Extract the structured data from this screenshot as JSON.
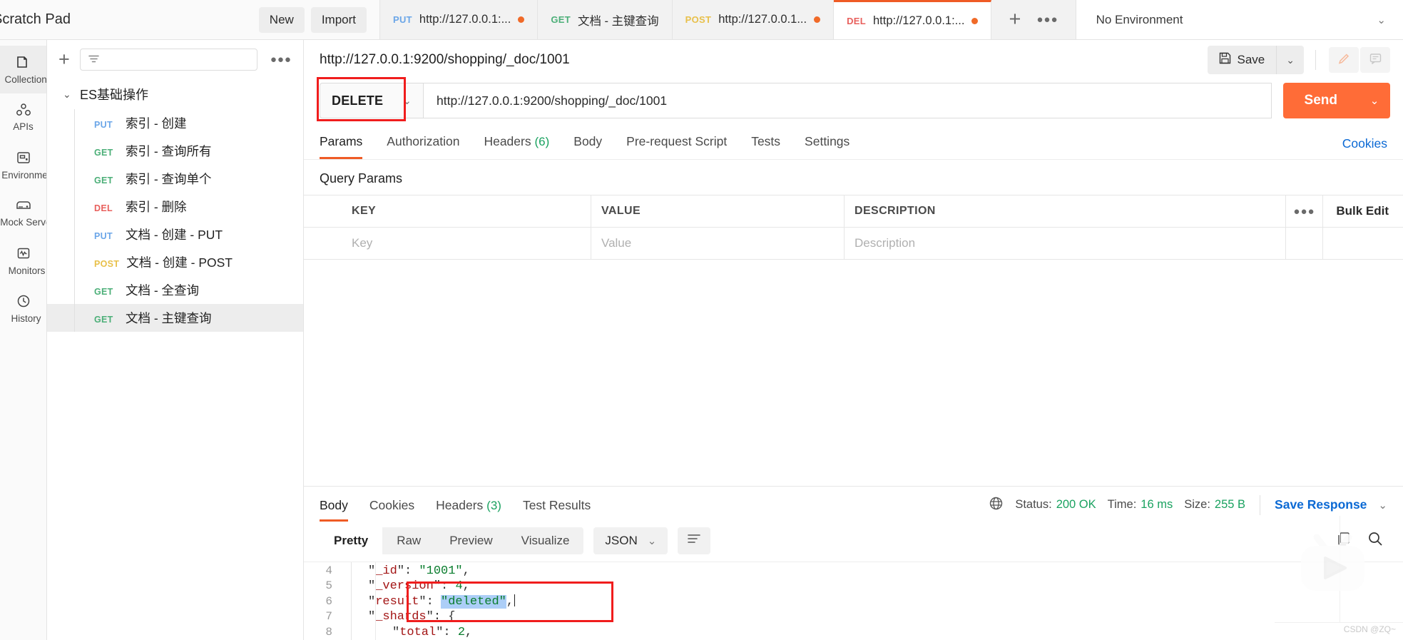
{
  "workspace": {
    "title": "Scratch Pad",
    "new_label": "New",
    "import_label": "Import"
  },
  "rail": {
    "items": [
      {
        "label": "Collections",
        "icon": "collections-icon",
        "active": true
      },
      {
        "label": "APIs",
        "icon": "apis-icon",
        "active": false
      },
      {
        "label": "Environments",
        "icon": "environments-icon",
        "active": false
      },
      {
        "label": "Mock Servers",
        "icon": "mock-servers-icon",
        "active": false
      },
      {
        "label": "Monitors",
        "icon": "monitors-icon",
        "active": false
      },
      {
        "label": "History",
        "icon": "history-icon",
        "active": false
      }
    ]
  },
  "sidebar": {
    "filter_placeholder": "",
    "collection": {
      "name": "ES基础操作",
      "expanded": true,
      "requests": [
        {
          "method": "PUT",
          "name": "索引 - 创建",
          "selected": false
        },
        {
          "method": "GET",
          "name": "索引 - 查询所有",
          "selected": false
        },
        {
          "method": "GET",
          "name": "索引 - 查询单个",
          "selected": false
        },
        {
          "method": "DEL",
          "name": "索引 - 删除",
          "selected": false
        },
        {
          "method": "PUT",
          "name": "文档 - 创建 - PUT",
          "selected": false
        },
        {
          "method": "POST",
          "name": "文档 - 创建 - POST",
          "selected": false
        },
        {
          "method": "GET",
          "name": "文档 - 全查询",
          "selected": false
        },
        {
          "method": "GET",
          "name": "文档 - 主键查询",
          "selected": true
        }
      ]
    }
  },
  "tabs": {
    "items": [
      {
        "method": "PUT",
        "title": "http://127.0.0.1:...",
        "unsaved": true,
        "active": false
      },
      {
        "method": "GET",
        "title": "文档 - 主键查询",
        "unsaved": false,
        "active": false
      },
      {
        "method": "POST",
        "title": "http://127.0.0.1...",
        "unsaved": true,
        "active": false
      },
      {
        "method": "DEL",
        "title": "http://127.0.0.1:...",
        "unsaved": true,
        "active": true
      }
    ],
    "environment": "No Environment"
  },
  "request": {
    "title": "http://127.0.0.1:9200/shopping/_doc/1001",
    "save_label": "Save",
    "method": "DELETE",
    "url": "http://127.0.0.1:9200/shopping/_doc/1001",
    "send_label": "Send",
    "tabs": [
      {
        "label": "Params",
        "badge": "",
        "active": true
      },
      {
        "label": "Authorization",
        "badge": "",
        "active": false
      },
      {
        "label": "Headers",
        "badge": "(6)",
        "active": false
      },
      {
        "label": "Body",
        "badge": "",
        "active": false
      },
      {
        "label": "Pre-request Script",
        "badge": "",
        "active": false
      },
      {
        "label": "Tests",
        "badge": "",
        "active": false
      },
      {
        "label": "Settings",
        "badge": "",
        "active": false
      }
    ],
    "cookies_link": "Cookies",
    "query_params_label": "Query Params",
    "table": {
      "headers": [
        "KEY",
        "VALUE",
        "DESCRIPTION"
      ],
      "bulk_edit_label": "Bulk Edit",
      "row_placeholders": [
        "Key",
        "Value",
        "Description"
      ]
    }
  },
  "response": {
    "tabs": [
      {
        "label": "Body",
        "badge": "",
        "active": true
      },
      {
        "label": "Cookies",
        "badge": "",
        "active": false
      },
      {
        "label": "Headers",
        "badge": "(3)",
        "active": false
      },
      {
        "label": "Test Results",
        "badge": "",
        "active": false
      }
    ],
    "status_label": "Status:",
    "status_value": "200 OK",
    "time_label": "Time:",
    "time_value": "16 ms",
    "size_label": "Size:",
    "size_value": "255 B",
    "save_response_label": "Save Response",
    "view_modes": [
      {
        "label": "Pretty",
        "active": true
      },
      {
        "label": "Raw",
        "active": false
      },
      {
        "label": "Preview",
        "active": false
      },
      {
        "label": "Visualize",
        "active": false
      }
    ],
    "format": "JSON",
    "body_lines": [
      {
        "no": "4",
        "indent": 1,
        "key": "_id",
        "colon": ": ",
        "value": "\"1001\"",
        "vtype": "string",
        "trail": ",",
        "selected": false
      },
      {
        "no": "5",
        "indent": 1,
        "key": "_version",
        "colon": ": ",
        "value": "4",
        "vtype": "number",
        "trail": ",",
        "selected": false
      },
      {
        "no": "6",
        "indent": 1,
        "key": "result",
        "colon": ": ",
        "value": "\"deleted\"",
        "vtype": "string",
        "trail": ",",
        "selected": true
      },
      {
        "no": "7",
        "indent": 1,
        "key": "_shards",
        "colon": ": ",
        "value": "{",
        "vtype": "punct",
        "trail": "",
        "selected": false
      },
      {
        "no": "8",
        "indent": 2,
        "key": "total",
        "colon": ": ",
        "value": "2",
        "vtype": "number",
        "trail": ",",
        "selected": false
      }
    ]
  },
  "watermark": {
    "text": "CSDN @ZQ~"
  },
  "colors": {
    "accent": "#ff6c37",
    "active_tab_border": "#ef5b25",
    "annotation": "#f01d1d",
    "link": "#0b69d4",
    "success": "#1aa260",
    "selection": "#accef7"
  }
}
